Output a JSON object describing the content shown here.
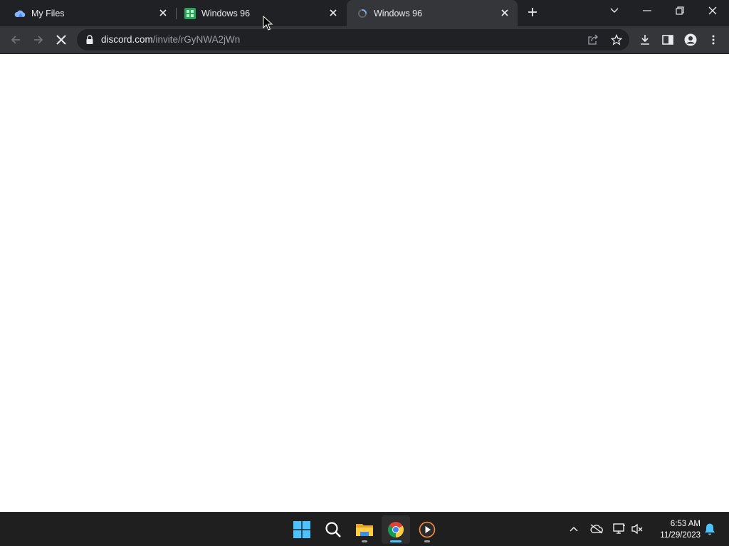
{
  "browser": {
    "tabs": [
      {
        "title": "My Files",
        "favicon": "cloud-drive-icon",
        "active": false
      },
      {
        "title": "Windows 96",
        "favicon": "windows96-icon",
        "active": false
      },
      {
        "title": "Windows 96",
        "favicon": "loading-icon",
        "active": true
      }
    ],
    "address_bar": {
      "domain": "discord.com",
      "path": "/invite/rGyNWA2jWn"
    }
  },
  "taskbar": {
    "apps": [
      {
        "name": "start",
        "icon": "windows-start-icon"
      },
      {
        "name": "search",
        "icon": "search-icon"
      },
      {
        "name": "file-explorer",
        "icon": "folder-icon"
      },
      {
        "name": "chrome",
        "icon": "chrome-icon"
      },
      {
        "name": "media-player",
        "icon": "media-play-icon"
      }
    ],
    "clock": {
      "time": "6:53 AM",
      "date": "11/29/2023"
    }
  },
  "colors": {
    "tabstrip_bg": "#202124",
    "toolbar_bg": "#35363a",
    "omnibox_bg": "#202124",
    "taskbar_bg": "#1f1f1f",
    "accent": "#4cc2ff"
  }
}
